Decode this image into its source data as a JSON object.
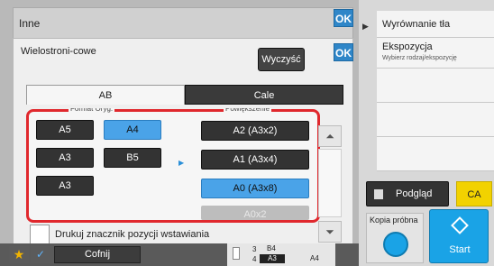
{
  "dialog_outer": {
    "title": "Inne",
    "ok": "OK"
  },
  "dialog_inner": {
    "title": "Wielostroni-cowe",
    "ok": "OK",
    "clear_button": "Wyczyść",
    "tabs": [
      {
        "label": "AB",
        "active": true
      },
      {
        "label": "Cale",
        "active": false
      }
    ],
    "format_label": "Format Oryg.",
    "enlarge_label": "Powiększenie",
    "format_buttons": [
      "A5",
      "A4",
      "A3",
      "B5",
      "A3"
    ],
    "format_selected": "A4",
    "enlarge_buttons": [
      "A2 (A3x2)",
      "A1 (A3x4)",
      "A0 (A3x8)",
      "A0x2"
    ],
    "enlarge_selected": "A0 (A3x8)",
    "print_marker_label": "Drukuj znacznik pozycji wstawiania"
  },
  "right_panel": {
    "item1": "Wyrównanie tła",
    "item2": "Ekspozycja",
    "item2_sub": "Wybierz rodzaj/ekspozycję",
    "preview": "Podgląd",
    "ca": "CA",
    "proof_copy": "Kopia próbna",
    "start": "Start"
  },
  "bottom_bar": {
    "back": "Cofnij",
    "status_top": "B4",
    "status_mid": "A3",
    "status_num3": "3",
    "status_num4": "4",
    "status_right": "A4"
  },
  "colors": {
    "accent": "#2f86c8",
    "selected": "#4aa3e8",
    "highlight": "#e0282d",
    "ca": "#f2d200",
    "start": "#1aa3e6"
  }
}
